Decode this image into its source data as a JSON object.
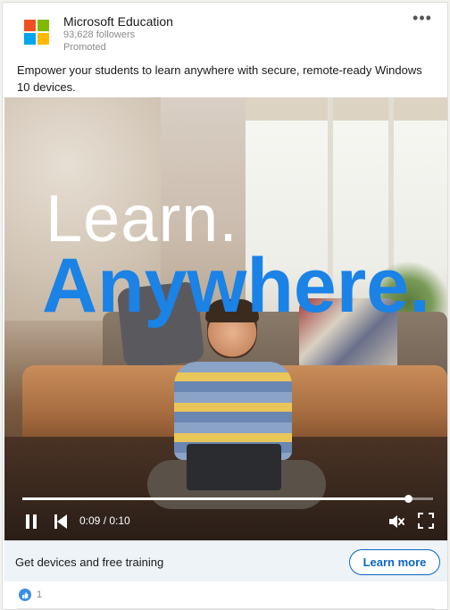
{
  "header": {
    "company_name": "Microsoft Education",
    "followers": "93,628 followers",
    "promoted": "Promoted",
    "more_label": "•••"
  },
  "post": {
    "text": "Empower your students to learn anywhere with secure, remote-ready Windows 10 devices."
  },
  "video": {
    "headline_line1": "Learn.",
    "headline_line2": "Anywhere.",
    "time": "0:09 / 0:10",
    "progress_fraction": 0.94,
    "muted": true
  },
  "cta": {
    "text": "Get devices and free training",
    "button_label": "Learn more"
  },
  "reactions": {
    "count": "1"
  },
  "colors": {
    "accent": "#0a66c2",
    "headline_blue": "#1b82e6"
  }
}
